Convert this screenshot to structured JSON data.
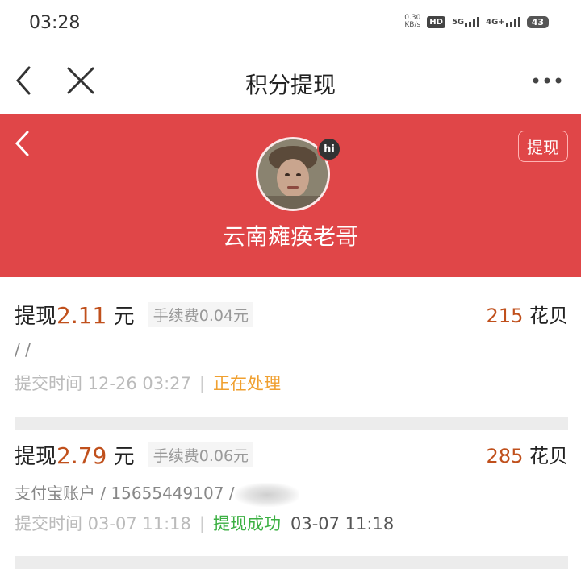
{
  "status_bar": {
    "time": "03:28",
    "net_speed_value": "0.30",
    "net_speed_unit": "KB/s",
    "hd_label": "HD",
    "signal1_label": "5G",
    "signal2_label": "4G+",
    "battery": "43"
  },
  "nav": {
    "title": "积分提现"
  },
  "profile": {
    "withdraw_button": "提现",
    "hi_badge": "hi",
    "username": "云南瘫痪老哥"
  },
  "records": [
    {
      "title_prefix": "提现",
      "amount": "2.11",
      "unit": "元",
      "fee": "手续费0.04元",
      "points_value": "215",
      "points_unit": "花贝",
      "account": "/ /",
      "time_label": "提交时间 12-26 03:27",
      "separator": "|",
      "status": "正在处理",
      "completed_time": ""
    },
    {
      "title_prefix": "提现",
      "amount": "2.79",
      "unit": "元",
      "fee": "手续费0.06元",
      "points_value": "285",
      "points_unit": "花贝",
      "account": "支付宝账户 / 15655449107 /",
      "time_label": "提交时间 03-07 11:18",
      "separator": "|",
      "status": "提现成功",
      "completed_time": "03-07 11:18"
    }
  ],
  "colors": {
    "header_red": "#e04648",
    "amount_orange": "#c0501c",
    "processing": "#f0a030",
    "success": "#3cb043"
  }
}
